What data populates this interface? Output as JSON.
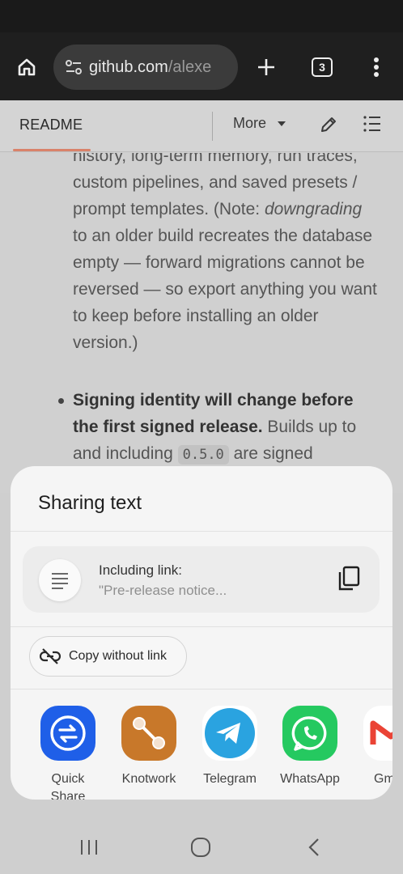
{
  "browser": {
    "url_host": "github.com",
    "url_path": "/alexe",
    "tab_count": "3"
  },
  "readme_bar": {
    "tab_label": "README",
    "more_label": "More"
  },
  "content": {
    "lines_before_italic": "history, long-term memory, run traces, custom pipelines, and saved presets / prompt templates. (Note: ",
    "italic_word": "downgrading",
    "lines_after_italic": " to an older build recreates the database empty — forward migrations cannot be reversed — so export anything you want to keep before installing an older version.)",
    "bullet_bold": "Signing identity will change before the first signed release.",
    "bullet_text": " Builds up to and including ",
    "bullet_code": "0.5.0",
    "bullet_tail": " are signed"
  },
  "share_sheet": {
    "title": "Sharing text",
    "link_label": "Including link:",
    "link_preview": "\"Pre-release notice...",
    "copy_without_link": "Copy without link",
    "apps": [
      {
        "label": "Quick\nShare",
        "icon": "quick-share-icon",
        "color": "#1f5fe8"
      },
      {
        "label": "Knotwork",
        "icon": "knotwork-icon",
        "color": "#c8782a"
      },
      {
        "label": "Telegram",
        "icon": "telegram-icon",
        "color": "#2aa3e0"
      },
      {
        "label": "WhatsApp",
        "icon": "whatsapp-icon",
        "color": "#25c960"
      },
      {
        "label": "Gm",
        "icon": "gmail-icon",
        "color": "#ea4335"
      }
    ]
  },
  "colors": {
    "toolbar_bg": "#1f1f1f",
    "accent_tab_underline": "#d9826a",
    "sheet_bg": "#f5f5f5"
  }
}
